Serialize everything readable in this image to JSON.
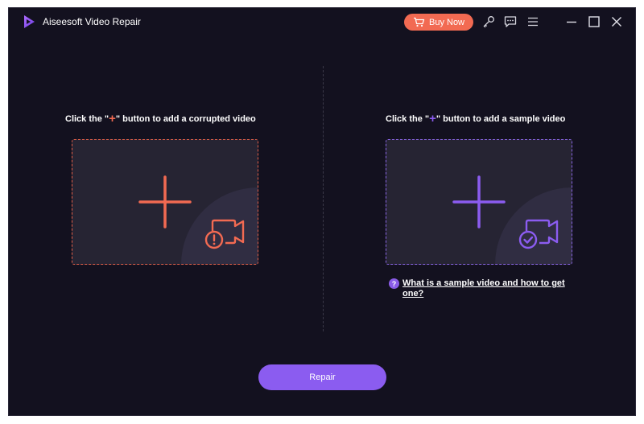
{
  "app": {
    "title": "Aiseesoft Video Repair",
    "accent": "#8b5cf0",
    "brand_orange": "#f26a52"
  },
  "titlebar": {
    "buy_label": "Buy Now",
    "icons": [
      "cart-icon",
      "key-icon",
      "feedback-icon",
      "menu-icon",
      "minimize-icon",
      "maximize-icon",
      "close-icon"
    ]
  },
  "left_panel": {
    "instruction_prefix": "Click the \"",
    "instruction_plus": "+",
    "instruction_suffix": "\" button to add a corrupted video",
    "plus_color": "#f26a52"
  },
  "right_panel": {
    "instruction_prefix": "Click the \"",
    "instruction_plus": "+",
    "instruction_suffix": "\" button to add a sample video",
    "plus_color": "#8b5cf0",
    "help_icon": "?",
    "help_link": "What is a sample video and how to get one?"
  },
  "footer": {
    "repair_label": "Repair"
  }
}
